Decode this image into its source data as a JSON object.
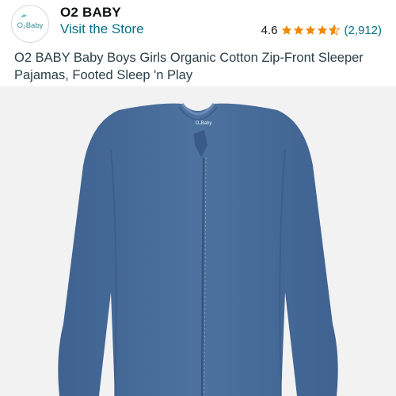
{
  "brand": {
    "name": "O2 BABY",
    "logo_text": "O₂Baby",
    "store_link_label": "Visit the Store"
  },
  "rating": {
    "value": "4.6",
    "stars": 4.6,
    "review_count": "(2,912)",
    "star_color": "#f08804"
  },
  "product": {
    "title": "O2 BABY Baby Boys Girls Organic Cotton Zip-Front Sleeper Pajamas, Footed Sleep 'n Play",
    "garment_color": "#4a6e9a",
    "image_background": "#f2f2f2"
  },
  "colors": {
    "link": "#007185",
    "text": "#0f1111"
  }
}
